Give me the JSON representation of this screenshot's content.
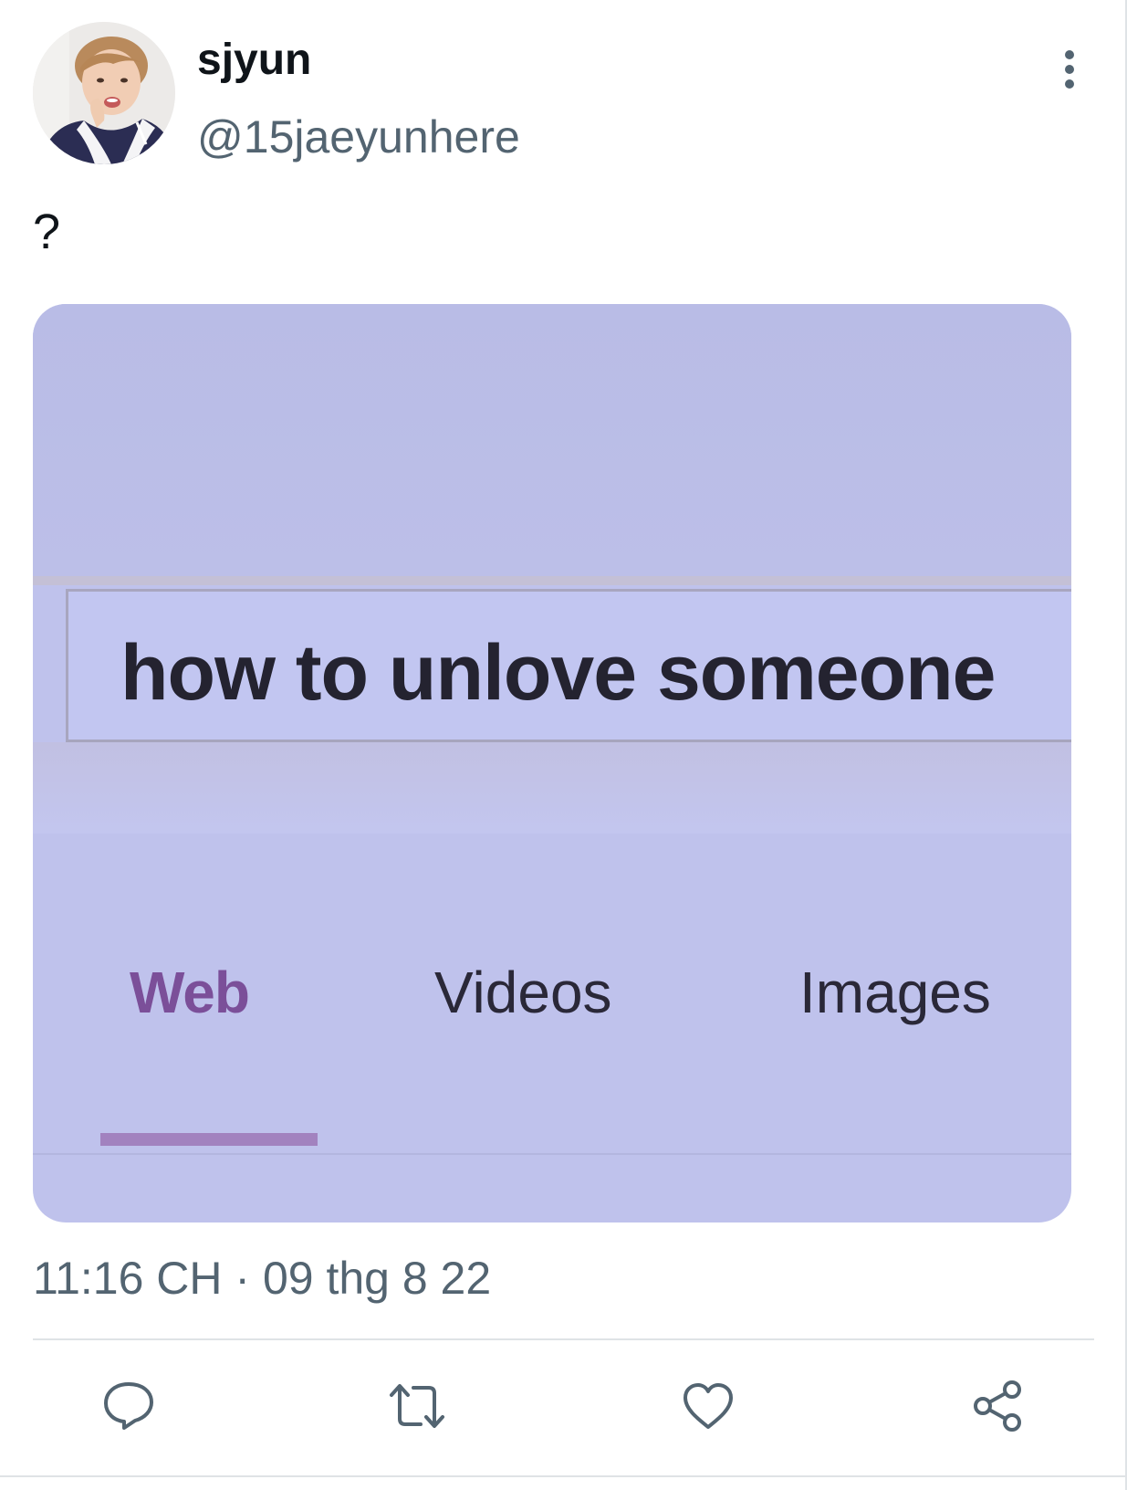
{
  "author": {
    "display_name": "sjyun",
    "handle": "@15jaeyunhere",
    "avatar_icon": "profile-photo"
  },
  "tweet": {
    "text": "?",
    "timestamp": "11:16 CH · 09 thg 8 22"
  },
  "media": {
    "search_query": "how to unlove someone",
    "tabs": [
      {
        "label": "Web",
        "active": true
      },
      {
        "label": "Videos",
        "active": false
      },
      {
        "label": "Images",
        "active": false
      }
    ],
    "background_color": "#bfc2ec",
    "active_tab_color": "#7b4f99"
  },
  "actions": [
    {
      "name": "reply",
      "icon": "reply-icon"
    },
    {
      "name": "retweet",
      "icon": "retweet-icon"
    },
    {
      "name": "like",
      "icon": "heart-icon"
    },
    {
      "name": "share",
      "icon": "share-icon"
    }
  ],
  "colors": {
    "text_primary": "#0f1419",
    "text_secondary": "#536471",
    "icon_color": "#536471",
    "divider": "#dfe3e6"
  }
}
